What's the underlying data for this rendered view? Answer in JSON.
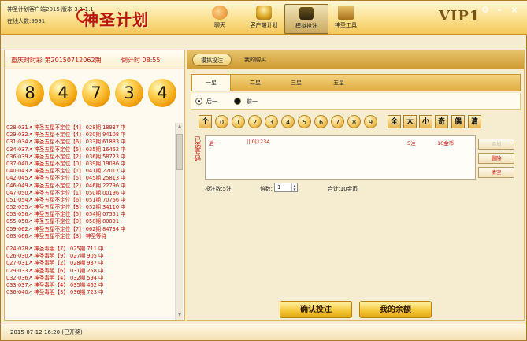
{
  "header": {
    "app_title": "神圣计划客户端2015  版本 3.1.1.1",
    "online_count": "在线人数:9691",
    "logo_text": "神圣计划",
    "vip_label": "VIP1",
    "nav": [
      {
        "label": "聊天",
        "icon": "chat-icon"
      },
      {
        "label": "客户端计划",
        "icon": "plan-icon"
      },
      {
        "label": "模拟投注",
        "icon": "simulate-bet-icon"
      },
      {
        "label": "神圣工具",
        "icon": "tools-icon"
      }
    ],
    "window_buttons": {
      "settings": "⚙",
      "minimize": "–",
      "close": "×"
    }
  },
  "lottery": {
    "name": "重庆时时彩 第20150712062期",
    "countdown": "倒计时 08:55",
    "draw_numbers": [
      "8",
      "4",
      "7",
      "3",
      "4"
    ]
  },
  "history": {
    "group1": [
      "028-031↗ 神圣五星不定位【4】 028期 18937 中",
      "029-032↗ 神圣五星不定位【4】 030期 94108 中",
      "031-034↗ 神圣五星不定位【6】 033期 61883 中",
      "034-037↗ 神圣五星不定位【5】 035期 16462 中",
      "036-039↗ 神圣五星不定位【2】 036期 58723 中",
      "037-040↗ 神圣五星不定位【0】 039期 19086 中",
      "040-043↗ 神圣五星不定位【1】 041期 22017 中",
      "042-045↗ 神圣五星不定位【5】 045期 25813 中",
      "046-049↗ 神圣五星不定位【2】 046期 22796 中",
      "047-050↗ 神圣五星不定位【1】 050期 00196 中",
      "051-054↗ 神圣五星不定位【6】 051期 70766 中",
      "052-055↗ 神圣五星不定位【3】 052期 34110 中",
      "053-056↗ 神圣五星不定位【5】 054期 07551 中",
      "055-058↗ 神圣五星不定位【0】 058期 80091 -",
      "059-062↗ 神圣五星不定位【7】 062期 84734 中",
      "063-066↗ 神圣五星不定位【3】 神圣等待"
    ],
    "group2": [
      "024-028↗ 神圣毒胆【7】 025期 711 中",
      "026-030↗ 神圣毒胆【9】 027期 905 中",
      "027-031↗ 神圣毒胆【2】 028期 937 中",
      "029-033↗ 神圣毒胆【6】 031期 258 中",
      "032-036↗ 神圣毒胆【4】 032期 594 中",
      "033-037↗ 神圣毒胆【4】 035期 462 中",
      "036-040↗ 神圣毒胆【3】 036期 723 中"
    ]
  },
  "right_tabs": [
    {
      "label": "模拟投注"
    },
    {
      "label": "我的购买"
    }
  ],
  "star_tabs": [
    {
      "label": "一星"
    },
    {
      "label": "二星"
    },
    {
      "label": "三星"
    },
    {
      "label": "五星"
    }
  ],
  "position": {
    "back": "后一",
    "front": "前一"
  },
  "number_buttons": [
    "个",
    "0",
    "1",
    "2",
    "3",
    "4",
    "5",
    "6",
    "7",
    "8",
    "9"
  ],
  "filter_buttons": [
    "全",
    "大",
    "小",
    "奇",
    "偶",
    "清"
  ],
  "selected_label": "已选号码",
  "bet_list": [
    {
      "pos": "后一",
      "numbers": "|||0|1234",
      "count": "5注",
      "amount": "10金币"
    }
  ],
  "side_buttons": {
    "add": "添加",
    "delete": "删除",
    "clear": "清空"
  },
  "bet_stats": {
    "count": "投注数:5注",
    "multiplier_label": "倍数:",
    "multiplier": "1",
    "total": "合计:10金币"
  },
  "actions": {
    "confirm": "确认投注",
    "balance": "我的余额"
  },
  "status": "2015-07-12 16:20 (已开奖)",
  "colors": {
    "accent_red": "#c0180e",
    "gold": "#f2c55a",
    "brown": "#7a5412"
  }
}
